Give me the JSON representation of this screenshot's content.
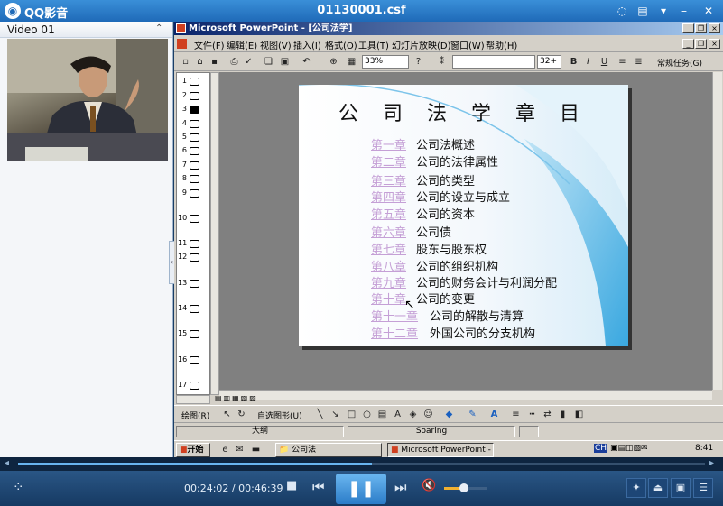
{
  "player": {
    "app_name": "QQ影音",
    "file_name": "01130001.csf",
    "current_time": "00:24:02",
    "separator": "/",
    "total_time": "00:46:39",
    "progress": 0.515,
    "volume": 0.45
  },
  "video_panel": {
    "label": "Video 01"
  },
  "powerpoint": {
    "title": "Microsoft PowerPoint - [公司法学]",
    "menu": [
      "文件(F)",
      "编辑(E)",
      "视图(V)",
      "插入(I)",
      "格式(O)",
      "工具(T)",
      "幻灯片放映(D)",
      "窗口(W)",
      "帮助(H)"
    ],
    "zoom": "33%",
    "font_size": "32+",
    "task_pane_label": "常规任务(G)",
    "outline_numbers": [
      "1",
      "2",
      "3",
      "4",
      "5",
      "6",
      "7",
      "8",
      "9",
      "10",
      "11",
      "12",
      "13",
      "14",
      "15",
      "16",
      "17"
    ],
    "draw_label": "绘图(R)",
    "autoshape_label": "自选图形(U)",
    "status_left": "大纲",
    "status_template": "Soaring",
    "taskbar": {
      "start": "开始",
      "folder_item": "公司法",
      "ppt_item": "Microsoft PowerPoint - [...",
      "clock": "8:41",
      "lang": "CH"
    }
  },
  "slide": {
    "title": "公 司 法 学 章 目",
    "chapters": [
      {
        "num": "第一章",
        "title": "公司法概述"
      },
      {
        "num": "第二章",
        "title": "公司的法律属性"
      },
      {
        "num": "第三章",
        "title": "公司的类型"
      },
      {
        "num": "第四章",
        "title": "公司的设立与成立"
      },
      {
        "num": "第五章",
        "title": "公司的资本"
      },
      {
        "num": "第六章",
        "title": "公司债"
      },
      {
        "num": "第七章",
        "title": "股东与股东权"
      },
      {
        "num": "第八章",
        "title": "公司的组织机构"
      },
      {
        "num": "第九章",
        "title": "公司的财务会计与利润分配"
      },
      {
        "num": "第十章",
        "title": "公司的变更"
      },
      {
        "num": "第十一章",
        "title": "公司的解散与清算"
      },
      {
        "num": "第十二章",
        "title": "外国公司的分支机构"
      }
    ]
  }
}
